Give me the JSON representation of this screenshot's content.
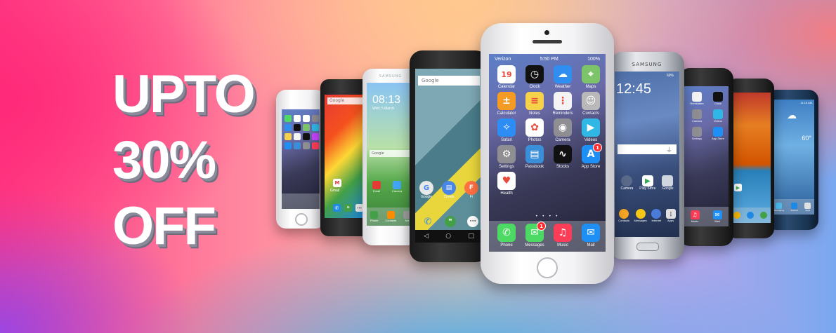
{
  "headline": {
    "line1": "UPTO",
    "line2": "30%",
    "line3": "OFF"
  },
  "center_phone": {
    "carrier": "Verizon",
    "time": "5:50 PM",
    "battery": "100%",
    "grid": [
      {
        "label": "Calendar",
        "icon": "calendar-icon",
        "color": "#ffffff",
        "glyph": "19"
      },
      {
        "label": "Clock",
        "icon": "clock-icon",
        "color": "#111111",
        "glyph": "◷"
      },
      {
        "label": "Weather",
        "icon": "weather-icon",
        "color": "#2f8ef0",
        "glyph": "☁"
      },
      {
        "label": "Maps",
        "icon": "maps-icon",
        "color": "#7cc36a",
        "glyph": "⌖"
      },
      {
        "label": "Calculator",
        "icon": "calculator-icon",
        "color": "#f59a23",
        "glyph": "±"
      },
      {
        "label": "Notes",
        "icon": "notes-icon",
        "color": "#f6d24a",
        "glyph": "≡"
      },
      {
        "label": "Reminders",
        "icon": "reminders-icon",
        "color": "#f4f4f4",
        "glyph": "⋮"
      },
      {
        "label": "Contacts",
        "icon": "contacts-icon",
        "color": "#b9b9b9",
        "glyph": "☺"
      },
      {
        "label": "Safari",
        "icon": "safari-icon",
        "color": "#2e8df5",
        "glyph": "✧"
      },
      {
        "label": "Photos",
        "icon": "photos-icon",
        "color": "#ffffff",
        "glyph": "✿"
      },
      {
        "label": "Camera",
        "icon": "camera-icon",
        "color": "#8e8e93",
        "glyph": "◉"
      },
      {
        "label": "Videos",
        "icon": "videos-icon",
        "color": "#2fb8e6",
        "glyph": "▶"
      },
      {
        "label": "Settings",
        "icon": "settings-icon",
        "color": "#8e8e93",
        "glyph": "⚙"
      },
      {
        "label": "Passbook",
        "icon": "passbook-icon",
        "color": "#3a8fd8",
        "glyph": "▤"
      },
      {
        "label": "Stocks",
        "icon": "stocks-icon",
        "color": "#111111",
        "glyph": "∿"
      },
      {
        "label": "App Store",
        "icon": "app-store-icon",
        "color": "#1e90f5",
        "glyph": "A",
        "badge": "1"
      },
      {
        "label": "Health",
        "icon": "health-icon",
        "color": "#ffffff",
        "glyph": "♥"
      }
    ],
    "dock": [
      {
        "label": "Phone",
        "icon": "phone-icon",
        "color": "#4cd964",
        "glyph": "✆"
      },
      {
        "label": "Messages",
        "icon": "messages-icon",
        "color": "#4cd964",
        "glyph": "✉",
        "badge": "1"
      },
      {
        "label": "Music",
        "icon": "music-icon",
        "color": "#fc3d57",
        "glyph": "♫"
      },
      {
        "label": "Mail",
        "icon": "mail-icon",
        "color": "#1e8ff5",
        "glyph": "✉"
      }
    ]
  },
  "samsung_s6": {
    "brand": "SAMSUNG",
    "battery": "69%",
    "time": "12:45",
    "apps": [
      {
        "label": "Camera",
        "icon": "camera-icon",
        "color": "#5a6a8a"
      },
      {
        "label": "Play Store",
        "icon": "play-store-icon",
        "color": "#ffffff"
      },
      {
        "label": "Google",
        "icon": "google-folder-icon",
        "color": "#d0d6e0"
      }
    ],
    "dock": [
      {
        "label": "Contacts",
        "icon": "contacts-icon",
        "color": "#f5a623"
      },
      {
        "label": "Messages",
        "icon": "messages-icon",
        "color": "#f5c518"
      },
      {
        "label": "Internet",
        "icon": "internet-icon",
        "color": "#4a7bd8"
      },
      {
        "label": "Apps",
        "icon": "apps-icon",
        "color": "#e0e0e0"
      }
    ]
  },
  "nexus_6": {
    "search": "Google",
    "apps": [
      {
        "label": "Google",
        "icon": "google-icon",
        "color": "#e8e8e8"
      },
      {
        "label": "Create",
        "icon": "create-icon",
        "color": "#4a86e8"
      },
      {
        "label": "Fi",
        "icon": "fi-icon",
        "color": "#ff7043"
      }
    ]
  },
  "galaxy_s5": {
    "brand": "SAMSUNG",
    "time": "08:13",
    "date": "Wed, 5 March",
    "search": "Google",
    "apps": [
      {
        "label": "Email",
        "icon": "email-icon",
        "color": "#e53935"
      },
      {
        "label": "Camera",
        "icon": "camera-icon",
        "color": "#42a5f5"
      }
    ],
    "dock": [
      {
        "label": "Phone",
        "icon": "phone-icon",
        "color": "#43a047"
      },
      {
        "label": "Contacts",
        "icon": "contacts-icon",
        "color": "#fb8c00"
      },
      {
        "label": "Mo",
        "icon": "more-icon",
        "color": "#9e9e9e"
      }
    ]
  },
  "nexus_5": {
    "search": "Google",
    "app_label": "Gmail"
  },
  "iphone_5s": {},
  "iphone_black": {
    "apps": [
      {
        "label": "Reminders",
        "icon": "reminders-icon",
        "color": "#f4f4f4"
      },
      {
        "label": "Clock",
        "icon": "clock-icon",
        "color": "#111111"
      },
      {
        "label": "Camera",
        "icon": "camera-icon",
        "color": "#8e8e93"
      },
      {
        "label": "Videos",
        "icon": "videos-icon",
        "color": "#2fb8e6"
      },
      {
        "label": "Settings",
        "icon": "settings-icon",
        "color": "#8e8e93"
      },
      {
        "label": "App Store",
        "icon": "app-store-icon",
        "color": "#1e90f5"
      }
    ],
    "dock": [
      {
        "label": "Music",
        "icon": "music-icon",
        "color": "#fc3d57"
      },
      {
        "label": "Mail",
        "icon": "mail-icon",
        "color": "#1e8ff5"
      }
    ]
  },
  "galaxy_s4": {
    "time": "11:18 AM",
    "temp": "60°",
    "dock": [
      {
        "label": "Messaging",
        "icon": "messaging-icon",
        "color": "#4fc3f7"
      },
      {
        "label": "Internet",
        "icon": "internet-icon",
        "color": "#1e88e5"
      },
      {
        "label": "Apps",
        "icon": "apps-icon",
        "color": "#e0e0e0"
      }
    ]
  },
  "moto_x": {}
}
